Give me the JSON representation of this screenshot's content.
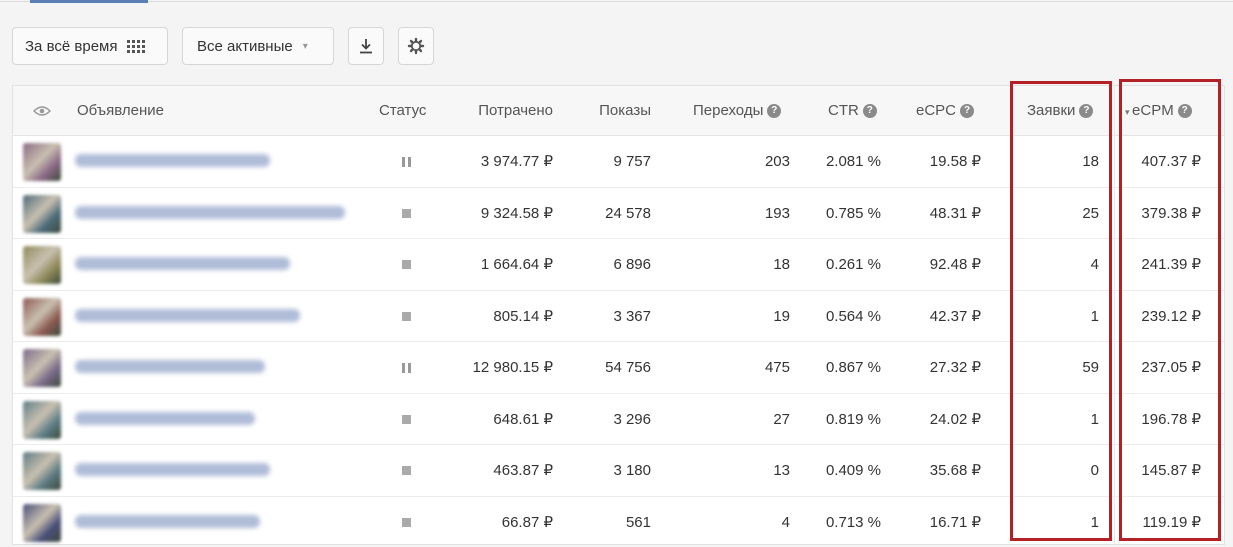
{
  "toolbar": {
    "period_label": "За всё время",
    "filter_label": "Все активные",
    "icons": [
      "calendar-grid-icon",
      "chevron-down-icon",
      "download-icon",
      "gear-icon"
    ]
  },
  "table": {
    "headers": {
      "ad": "Объявление",
      "status": "Статус",
      "spent": "Потрачено",
      "impressions": "Показы",
      "clicks": "Переходы",
      "ctr": "CTR",
      "ecpc": "eCPC",
      "leads": "Заявки",
      "ecpm": "eCPM"
    },
    "rows": [
      {
        "status": "paused",
        "spent": "3 974.77 ₽",
        "impressions": "9 757",
        "clicks": "203",
        "ctr": "2.081 %",
        "ecpc": "19.58 ₽",
        "leads": "18",
        "ecpm": "407.37 ₽"
      },
      {
        "status": "stopped",
        "spent": "9 324.58 ₽",
        "impressions": "24 578",
        "clicks": "193",
        "ctr": "0.785 %",
        "ecpc": "48.31 ₽",
        "leads": "25",
        "ecpm": "379.38 ₽"
      },
      {
        "status": "stopped",
        "spent": "1 664.64 ₽",
        "impressions": "6 896",
        "clicks": "18",
        "ctr": "0.261 %",
        "ecpc": "92.48 ₽",
        "leads": "4",
        "ecpm": "241.39 ₽"
      },
      {
        "status": "stopped",
        "spent": "805.14 ₽",
        "impressions": "3 367",
        "clicks": "19",
        "ctr": "0.564 %",
        "ecpc": "42.37 ₽",
        "leads": "1",
        "ecpm": "239.12 ₽"
      },
      {
        "status": "paused",
        "spent": "12 980.15 ₽",
        "impressions": "54 756",
        "clicks": "475",
        "ctr": "0.867 %",
        "ecpc": "27.32 ₽",
        "leads": "59",
        "ecpm": "237.05 ₽"
      },
      {
        "status": "stopped",
        "spent": "648.61 ₽",
        "impressions": "3 296",
        "clicks": "27",
        "ctr": "0.819 %",
        "ecpc": "24.02 ₽",
        "leads": "1",
        "ecpm": "196.78 ₽"
      },
      {
        "status": "stopped",
        "spent": "463.87 ₽",
        "impressions": "3 180",
        "clicks": "13",
        "ctr": "0.409 %",
        "ecpc": "35.68 ₽",
        "leads": "0",
        "ecpm": "145.87 ₽"
      },
      {
        "status": "stopped",
        "spent": "66.87 ₽",
        "impressions": "561",
        "clicks": "4",
        "ctr": "0.713 %",
        "ecpc": "16.71 ₽",
        "leads": "1",
        "ecpm": "119.19 ₽"
      }
    ]
  },
  "colors": {
    "highlight": "#b32025",
    "accent": "#5a7fb5",
    "thumbs": [
      "#8b6a86",
      "#4d6b7a",
      "#8f8a5a",
      "#8d5a52",
      "#7a6a8a",
      "#5f7e86",
      "#5c7a82",
      "#4a4f7a"
    ]
  }
}
